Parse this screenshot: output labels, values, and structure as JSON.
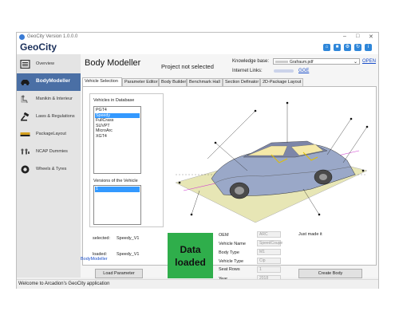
{
  "window": {
    "title": "GeoCity Version 1.0.0.0",
    "brand": "GeoCity"
  },
  "sidebar": {
    "items": [
      {
        "label": "Overview",
        "icon": "list-icon"
      },
      {
        "label": "BodyModeller",
        "icon": "car-icon",
        "active": true
      },
      {
        "label": "Manikin & Interieur",
        "icon": "manikin-icon"
      },
      {
        "label": "Laws & Regulations",
        "icon": "gavel-icon"
      },
      {
        "label": "PackageLayout",
        "icon": "package-icon"
      },
      {
        "label": "NCAP Dummies",
        "icon": "dummies-icon"
      },
      {
        "label": "Wheels & Tyres",
        "icon": "tyre-icon"
      }
    ]
  },
  "header": {
    "title": "Body Modeller",
    "project_status": "Project not selected",
    "knowledge_base_label": "Knowledge base:",
    "knowledge_base_value": "Grafraum.pdf",
    "open_link": "OPEN",
    "internet_links_label": "Internet Links:",
    "goe_link": "GOE"
  },
  "tabs": [
    {
      "label": "Vehicle Selection",
      "active": true
    },
    {
      "label": "Parameter Editor"
    },
    {
      "label": "Body Builder"
    },
    {
      "label": "Benchmark Hall"
    },
    {
      "label": "Section Definator"
    },
    {
      "label": "2D-Package Layout"
    }
  ],
  "vehicle_selection": {
    "db_label": "Vehicles in Database",
    "vehicles": [
      "PGT4",
      "Speedy",
      "FullCrass",
      "SUVPT",
      "MicroArc",
      "XGT4"
    ],
    "selected_vehicle_index": 1,
    "versions_label": "Versions of the Vehicle",
    "versions": [
      "1"
    ],
    "selected_label": "selected:",
    "selected_value": "Speedy_V1",
    "loaded_label": "loaded:",
    "loaded_value": "Speedy_V1",
    "load_button": "Load Parameter",
    "status_line1": "Data",
    "status_line2": "loaded",
    "status_color": "#2fae4b"
  },
  "properties": [
    {
      "label": "OEM",
      "value": "ARC"
    },
    {
      "label": "Vehicle Name",
      "value": "SpeedCoupe"
    },
    {
      "label": "Body Type",
      "value": "M1"
    },
    {
      "label": "Vehicle Type",
      "value": "Cip"
    },
    {
      "label": "Seat Rows",
      "value": "1"
    },
    {
      "label": "Year",
      "value": "2018"
    }
  ],
  "just_made": "Just made it",
  "create_button": "Create Body",
  "footer_link": "BodyModeller",
  "status_text": "Welcome to Arcadion's GeoCity application",
  "colors": {
    "accent": "#4a6fa5",
    "brand": "#1a2f5a",
    "toolbar": "#2e86d9"
  }
}
